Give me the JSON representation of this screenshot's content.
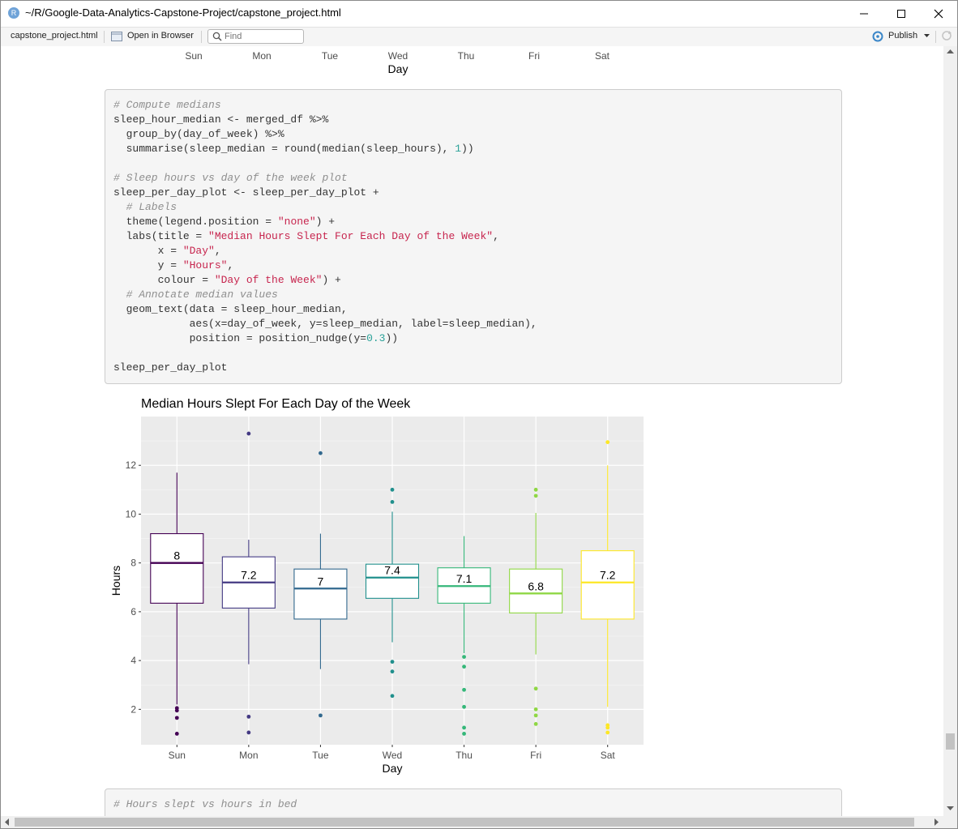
{
  "window": {
    "title": "~/R/Google-Data-Analytics-Capstone-Project/capstone_project.html",
    "app_icon_letter": "R"
  },
  "toolbar": {
    "file_label": "capstone_project.html",
    "open_in_browser": "Open in Browser",
    "find_placeholder": "Find",
    "publish_label": "Publish"
  },
  "top_chart_axis": {
    "tick_labels": [
      "Sun",
      "Mon",
      "Tue",
      "Wed",
      "Thu",
      "Fri",
      "Sat"
    ],
    "xlabel": "Day"
  },
  "code_block_1": {
    "lines": [
      [
        {
          "c": "cm",
          "t": "# Compute medians"
        }
      ],
      [
        {
          "c": "",
          "t": "sleep_hour_median <- merged_df %>%"
        }
      ],
      [
        {
          "c": "",
          "t": "  group_by(day_of_week) %>%"
        }
      ],
      [
        {
          "c": "",
          "t": "  summarise(sleep_median = round(median(sleep_hours), "
        },
        {
          "c": "nu",
          "t": "1"
        },
        {
          "c": "",
          "t": "))"
        }
      ],
      [
        {
          "c": "",
          "t": ""
        }
      ],
      [
        {
          "c": "cm",
          "t": "# Sleep hours vs day of the week plot"
        }
      ],
      [
        {
          "c": "",
          "t": "sleep_per_day_plot <- sleep_per_day_plot +"
        }
      ],
      [
        {
          "c": "cm",
          "t": "  # Labels"
        }
      ],
      [
        {
          "c": "",
          "t": "  theme(legend.position = "
        },
        {
          "c": "st",
          "t": "\"none\""
        },
        {
          "c": "",
          "t": ") +"
        }
      ],
      [
        {
          "c": "",
          "t": "  labs(title = "
        },
        {
          "c": "st",
          "t": "\"Median Hours Slept For Each Day of the Week\""
        },
        {
          "c": "",
          "t": ","
        }
      ],
      [
        {
          "c": "",
          "t": "       x = "
        },
        {
          "c": "st",
          "t": "\"Day\""
        },
        {
          "c": "",
          "t": ","
        }
      ],
      [
        {
          "c": "",
          "t": "       y = "
        },
        {
          "c": "st",
          "t": "\"Hours\""
        },
        {
          "c": "",
          "t": ","
        }
      ],
      [
        {
          "c": "",
          "t": "       colour = "
        },
        {
          "c": "st",
          "t": "\"Day of the Week\""
        },
        {
          "c": "",
          "t": ") +"
        }
      ],
      [
        {
          "c": "cm",
          "t": "  # Annotate median values"
        }
      ],
      [
        {
          "c": "",
          "t": "  geom_text(data = sleep_hour_median,"
        }
      ],
      [
        {
          "c": "",
          "t": "            aes(x=day_of_week, y=sleep_median, label=sleep_median),"
        }
      ],
      [
        {
          "c": "",
          "t": "            position = position_nudge(y="
        },
        {
          "c": "nu",
          "t": "0.3"
        },
        {
          "c": "",
          "t": "))"
        }
      ],
      [
        {
          "c": "",
          "t": ""
        }
      ],
      [
        {
          "c": "",
          "t": "sleep_per_day_plot"
        }
      ]
    ]
  },
  "code_block_2": {
    "lines": [
      [
        {
          "c": "cm",
          "t": "# Hours slept vs hours in bed"
        }
      ]
    ]
  },
  "chart_data": {
    "type": "boxplot",
    "title": "Median Hours Slept For Each Day of the Week",
    "xlabel": "Day",
    "ylabel": "Hours",
    "ylim": [
      0.55,
      14.0
    ],
    "yticks": [
      2,
      4,
      6,
      8,
      10,
      12
    ],
    "grid": true,
    "legend": "none",
    "panel_bg": "#ebebeb",
    "categories": [
      "Sun",
      "Mon",
      "Tue",
      "Wed",
      "Thu",
      "Fri",
      "Sat"
    ],
    "colors": [
      "#440154",
      "#443a83",
      "#31688e",
      "#21908d",
      "#35b779",
      "#8fd744",
      "#fde725"
    ],
    "boxes": [
      {
        "day": "Sun",
        "q1": 6.35,
        "median": 8.0,
        "q3": 9.2,
        "whisker_low": 2.2,
        "whisker_high": 11.7,
        "outliers": [
          2.05,
          1.95,
          1.65,
          1.0
        ],
        "label": "8"
      },
      {
        "day": "Mon",
        "q1": 6.15,
        "median": 7.2,
        "q3": 8.25,
        "whisker_low": 3.85,
        "whisker_high": 8.95,
        "outliers": [
          13.3,
          1.7,
          1.05
        ],
        "label": "7.2"
      },
      {
        "day": "Tue",
        "q1": 5.7,
        "median": 6.95,
        "q3": 7.75,
        "whisker_low": 3.65,
        "whisker_high": 9.2,
        "outliers": [
          12.5,
          1.75
        ],
        "label": "7"
      },
      {
        "day": "Wed",
        "q1": 6.55,
        "median": 7.4,
        "q3": 7.95,
        "whisker_low": 4.75,
        "whisker_high": 10.1,
        "outliers": [
          11.0,
          10.5,
          3.95,
          3.55,
          2.55
        ],
        "label": "7.4"
      },
      {
        "day": "Thu",
        "q1": 6.35,
        "median": 7.05,
        "q3": 7.8,
        "whisker_low": 4.3,
        "whisker_high": 9.1,
        "outliers": [
          4.15,
          3.75,
          2.8,
          2.1,
          1.25,
          1.0
        ],
        "label": "7.1"
      },
      {
        "day": "Fri",
        "q1": 5.95,
        "median": 6.75,
        "q3": 7.75,
        "whisker_low": 4.25,
        "whisker_high": 10.05,
        "outliers": [
          11.0,
          10.75,
          2.85,
          2.0,
          1.75,
          1.4
        ],
        "label": "6.8"
      },
      {
        "day": "Sat",
        "q1": 5.7,
        "median": 7.2,
        "q3": 8.5,
        "whisker_low": 2.1,
        "whisker_high": 12.0,
        "outliers": [
          12.95,
          1.35,
          1.25,
          1.05
        ],
        "label": "7.2"
      }
    ]
  }
}
